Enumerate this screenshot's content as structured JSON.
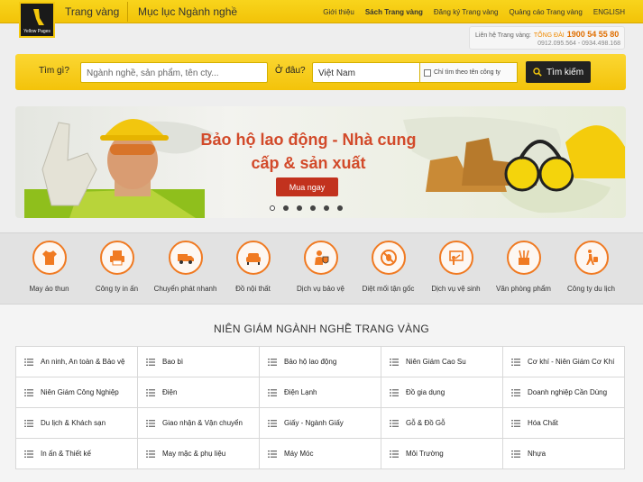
{
  "header": {
    "logo_text": "Yellow Pages",
    "brand": "Trang vàng",
    "catalog": "Mục lục Ngành nghề",
    "nav": [
      "Giới thiệu",
      "Sách Trang vàng",
      "Đăng ký Trang vàng",
      "Quảng cáo Trang vàng",
      "ENGLISH"
    ]
  },
  "hotline": {
    "label": "Liên hệ Trang vàng:",
    "tongdai": "TỔNG ĐÀI",
    "number": "1900 54 55 80",
    "phones": "0912.095.564 - 0934.498.168"
  },
  "search": {
    "what_label": "Tìm gì?",
    "what_placeholder": "Ngành nghề, sản phẩm, tên cty...",
    "where_label": "Ở đâu?",
    "where_value": "Việt Nam",
    "checkbox_label": "Chỉ tìm theo tên công ty",
    "button": "Tìm kiếm"
  },
  "banner": {
    "line1": "Bảo hộ lao động - Nhà cung",
    "line2": "cấp & sản xuất",
    "button": "Mua ngay",
    "slides": 6,
    "active_slide": 0
  },
  "categories": [
    {
      "label": "May áo thun",
      "icon": "tshirt-icon"
    },
    {
      "label": "Công ty in ấn",
      "icon": "printer-icon"
    },
    {
      "label": "Chuyển phát nhanh",
      "icon": "truck-icon"
    },
    {
      "label": "Đồ nội thất",
      "icon": "sofa-icon"
    },
    {
      "label": "Dịch vụ bảo vệ",
      "icon": "guard-icon"
    },
    {
      "label": "Diệt mối tận gốc",
      "icon": "no-pest-icon"
    },
    {
      "label": "Dịch vụ vệ sinh",
      "icon": "cleaning-icon"
    },
    {
      "label": "Văn phòng phẩm",
      "icon": "stationery-icon"
    },
    {
      "label": "Công ty du lịch",
      "icon": "traveler-icon"
    }
  ],
  "directory": {
    "title": "NIÊN GIÁM NGÀNH NGHỀ TRANG VÀNG",
    "items": [
      "An ninh, An toàn & Bảo vệ",
      "Bao bì",
      "Bảo hộ lao động",
      "Niên Giám Cao Su",
      "Cơ khí - Niên Giám Cơ Khí",
      "Niên Giám Công Nghiệp",
      "Điện",
      "Điện Lạnh",
      "Đồ gia dụng",
      "Doanh nghiệp Cần Dùng",
      "Du lịch & Khách sạn",
      "Giao nhận & Vận chuyển",
      "Giấy - Ngành Giấy",
      "Gỗ & Đồ Gỗ",
      "Hóa Chất",
      "In ấn & Thiết kế",
      "May mặc & phụ liệu",
      "Máy Móc",
      "Môi Trường",
      "Nhựa"
    ]
  },
  "colors": {
    "brand_yellow": "#f4c80c",
    "accent_orange": "#f07a22",
    "banner_red": "#c2321e"
  }
}
